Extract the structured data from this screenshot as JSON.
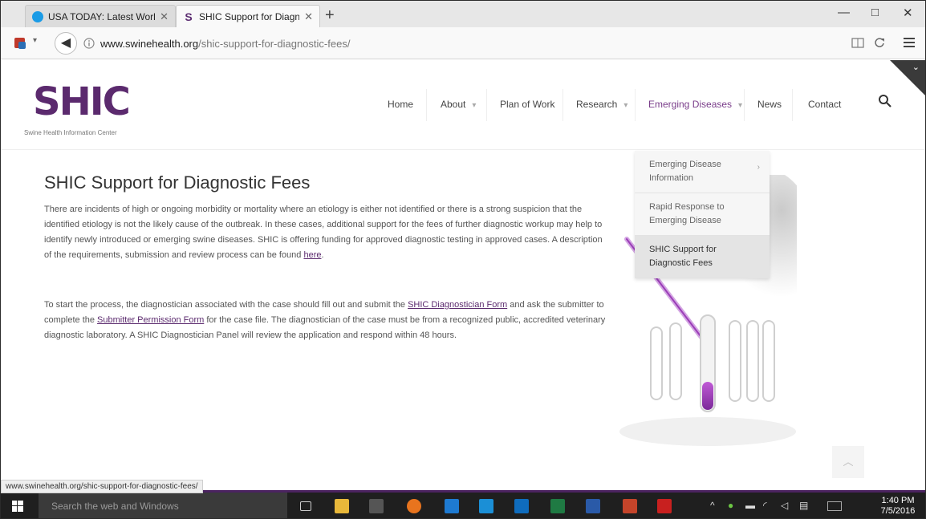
{
  "browser": {
    "tabs": [
      {
        "label": "USA TODAY: Latest World...",
        "favicon_color": "#1a9be6"
      },
      {
        "label": "SHIC Support for Diagnos...",
        "favicon": "S"
      }
    ],
    "new_tab": "+",
    "window_controls": {
      "minimize": "—",
      "maximize": "□",
      "close": "✕"
    },
    "url": {
      "domain": "www.swinehealth.org",
      "path": "/shic-support-for-diagnostic-fees/"
    }
  },
  "site": {
    "logo_text": "SHIC",
    "logo_subtitle": "Swine Health Information Center",
    "nav": [
      {
        "label": "Home",
        "has_caret": false
      },
      {
        "label": "About",
        "has_caret": true
      },
      {
        "label": "Plan of Work",
        "has_caret": false
      },
      {
        "label": "Research",
        "has_caret": true
      },
      {
        "label": "Emerging Diseases",
        "has_caret": true
      },
      {
        "label": "News",
        "has_caret": false
      },
      {
        "label": "Contact",
        "has_caret": false
      }
    ],
    "dropdown": [
      {
        "label": "Emerging Disease Information",
        "has_arrow": true
      },
      {
        "label": "Rapid Response to Emerging Disease",
        "has_arrow": false
      },
      {
        "label": "SHIC Support for Diagnostic Fees",
        "has_arrow": false
      }
    ]
  },
  "content": {
    "title": "SHIC Support for Diagnostic Fees",
    "para1_text": "There are incidents of high or ongoing morbidity or mortality where an etiology is either not identified or there is a strong suspicion that the identified etiology is not the likely cause of the outbreak.  In these cases, additional support for the fees of further diagnostic workup may help to identify newly introduced or emerging swine diseases.  SHIC is offering funding for approved diagnostic testing in approved cases.  A description of the requirements, submission and review process can be found ",
    "para1_link": "here",
    "para1_end": ".",
    "para2_a": "To start the process, the diagnostician associated with the case should fill out and submit the ",
    "para2_link1": "SHIC Diagnostician Form",
    "para2_b": " and ask the submitter to complete the ",
    "para2_link2": "Submitter Permission Form",
    "para2_c": " for the case file.  The diagnostician of the case must be from a recognized public, accredited veterinary diagnostic laboratory.  A SHIC Diagnostician Panel will review the application and respond within 48 hours."
  },
  "status_bar_url": "www.swinehealth.org/shic-support-for-diagnostic-fees/",
  "taskbar": {
    "search_placeholder": "Search the web and Windows",
    "time": "1:40 PM",
    "date": "7/5/2016"
  },
  "colors": {
    "brand": "#5b2a6e",
    "accent": "#7a3d8a"
  }
}
